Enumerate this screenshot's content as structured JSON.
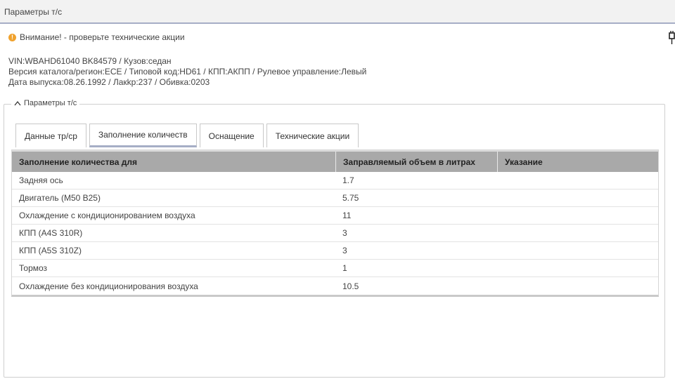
{
  "window": {
    "title": "Параметры т/с"
  },
  "warning": {
    "text": "Внимание! - проверьте технические акции"
  },
  "vehicle_info": {
    "line1": "VIN:WBAHD61040 BK84579 / Кузов:седан",
    "line2": "Версия каталога/регион:ECE / Типовой код:HD61 / КПП:АКПП / Рулевое управление:Левый",
    "line3": "Дата выпуска:08.26.1992 / Лакkр:237 / Обивка:0203"
  },
  "section": {
    "legend": "Параметры т/с"
  },
  "tabs": [
    {
      "label": "Данные тр/ср",
      "active": false
    },
    {
      "label": "Заполнение количеств",
      "active": true
    },
    {
      "label": "Оснащение",
      "active": false
    },
    {
      "label": "Технические акции",
      "active": false
    }
  ],
  "table": {
    "headers": [
      "Заполнение количества для",
      "Заправляемый объем в литрах",
      "Указание"
    ],
    "rows": [
      [
        "Задняя ось",
        "1.7",
        ""
      ],
      [
        "Двигатель (M50 B25)",
        "5.75",
        ""
      ],
      [
        "Охлаждение с кондиционированием воздуха",
        "11",
        ""
      ],
      [
        "КПП (A4S 310R)",
        "3",
        ""
      ],
      [
        "КПП (A5S 310Z)",
        "3",
        ""
      ],
      [
        "Тормоз",
        "1",
        ""
      ],
      [
        "Охлаждение без кондиционирования воздуха",
        "10.5",
        ""
      ]
    ]
  },
  "colors": {
    "accent": "#a6aec6",
    "header_bg": "#a9a9a9",
    "warning": "#f0a22e"
  },
  "icons": {
    "warning": "warning-circle-icon",
    "collapse": "chevron-up-icon",
    "plug": "plug-icon"
  }
}
